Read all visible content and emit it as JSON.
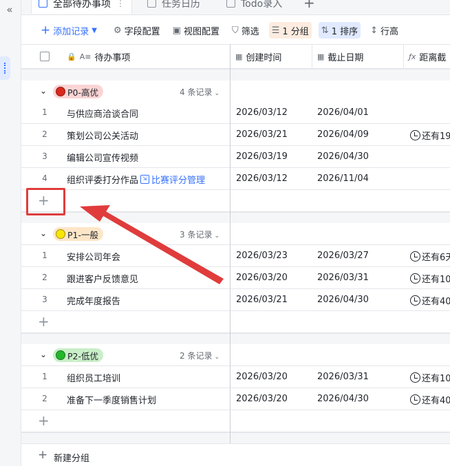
{
  "sidebar": {
    "collapse_glyph": "«"
  },
  "tabs": [
    {
      "label": "全部待办事项",
      "more": "⋮",
      "icon": "table-icon"
    },
    {
      "label": "任务日历",
      "icon": "calendar-icon"
    },
    {
      "label": "Todo录入",
      "icon": "form-icon"
    }
  ],
  "tab_add_glyph": "+",
  "toolbar": {
    "add_record": "添加记录",
    "field_config": "字段配置",
    "view_config": "视图配置",
    "filter": "筛选",
    "group": "1 分组",
    "sort": "1 排序",
    "row_height": "行高"
  },
  "columns": {
    "todo": "待办事项",
    "created": "创建时间",
    "deadline": "截止日期",
    "remaining": "距离截"
  },
  "groups": [
    {
      "name": "P0-高优",
      "count": "4 条记录",
      "tag_bg": "#fbd4d4",
      "dot": "#d9281e",
      "rows": [
        {
          "n": "1",
          "title": "与供应商洽谈合同",
          "link": "",
          "created": "2026/03/12",
          "deadline": "2026/04/01",
          "remain": ""
        },
        {
          "n": "2",
          "title": "策划公司公关活动",
          "link": "",
          "created": "2026/03/21",
          "deadline": "2026/04/09",
          "remain": "还有19"
        },
        {
          "n": "3",
          "title": "编辑公司宣传视频",
          "link": "",
          "created": "2026/03/19",
          "deadline": "2026/04/30",
          "remain": ""
        },
        {
          "n": "4",
          "title": "组织评委打分作品",
          "link": "比赛评分管理",
          "created": "2026/03/12",
          "deadline": "2026/11/04",
          "remain": ""
        }
      ]
    },
    {
      "name": "P1-一般",
      "count": "3 条记录",
      "tag_bg": "#fde6c8",
      "dot": "#f7e600",
      "rows": [
        {
          "n": "1",
          "title": "安排公司年会",
          "link": "",
          "created": "2026/03/23",
          "deadline": "2026/03/27",
          "remain": "还有6天"
        },
        {
          "n": "2",
          "title": "跟进客户反馈意见",
          "link": "",
          "created": "2026/03/20",
          "deadline": "2026/03/31",
          "remain": "还有10"
        },
        {
          "n": "3",
          "title": "完成年度报告",
          "link": "",
          "created": "2026/03/21",
          "deadline": "2026/04/30",
          "remain": "还有40"
        }
      ]
    },
    {
      "name": "P2-低优",
      "count": "2 条记录",
      "tag_bg": "#c9eec8",
      "dot": "#22b82c",
      "rows": [
        {
          "n": "1",
          "title": "组织员工培训",
          "link": "",
          "created": "2026/03/20",
          "deadline": "2026/03/31",
          "remain": "还有10"
        },
        {
          "n": "2",
          "title": "准备下一季度销售计划",
          "link": "",
          "created": "2026/03/20",
          "deadline": "2026/04/30",
          "remain": "还有40"
        }
      ]
    }
  ],
  "add_row_glyph": "+",
  "footer": {
    "new_group": "新建分组"
  },
  "annotation_color": "#e03c3c"
}
